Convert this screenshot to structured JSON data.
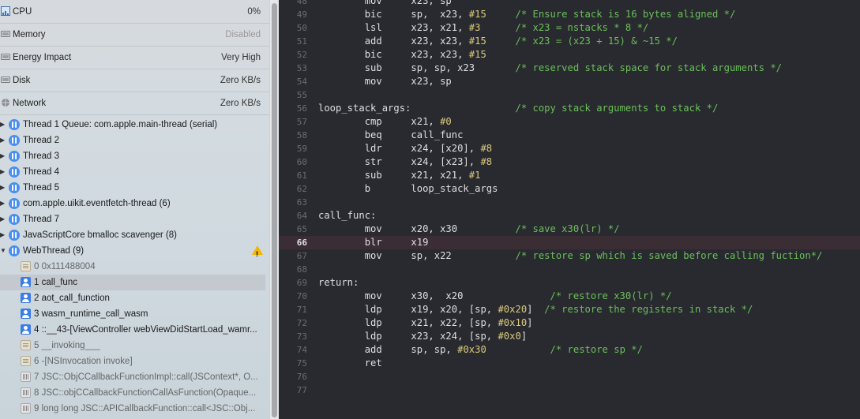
{
  "gauges": [
    {
      "name": "CPU",
      "value": "0%",
      "icon": "cpu-gauge-icon"
    },
    {
      "name": "Memory",
      "value": "Disabled",
      "icon": "memory-gauge-icon"
    },
    {
      "name": "Energy Impact",
      "value": "Very High",
      "icon": "energy-gauge-icon"
    },
    {
      "name": "Disk",
      "value": "Zero KB/s",
      "icon": "disk-gauge-icon"
    },
    {
      "name": "Network",
      "value": "Zero KB/s",
      "icon": "network-gauge-icon"
    }
  ],
  "threads": [
    "Thread 1 Queue: com.apple.main-thread (serial)",
    "Thread 2",
    "Thread 3",
    "Thread 4",
    "Thread 5",
    "com.apple.uikit.eventfetch-thread (6)",
    "Thread 7",
    "JavaScriptCore bmalloc scavenger (8)",
    "WebThread (9)"
  ],
  "frames": [
    {
      "label": "0 0x111488004",
      "kind": "sys"
    },
    {
      "label": "1 call_func",
      "kind": "user"
    },
    {
      "label": "2 aot_call_function",
      "kind": "user"
    },
    {
      "label": "3 wasm_runtime_call_wasm",
      "kind": "user"
    },
    {
      "label": "4 ::__43-[ViewController webViewDidStartLoad_wamr...",
      "kind": "user"
    },
    {
      "label": "5 __invoking___",
      "kind": "sys"
    },
    {
      "label": "6 -[NSInvocation invoke]",
      "kind": "sys"
    },
    {
      "label": "7 JSC::ObjCCallbackFunctionImpl::call(JSContext*, O...",
      "kind": "lib"
    },
    {
      "label": "8 JSC::objCCallbackFunctionCallAsFunction(Opaque...",
      "kind": "lib"
    },
    {
      "label": "9 long long JSC::APICallbackFunction::call<JSC::Obj...",
      "kind": "lib"
    }
  ],
  "selected_frame": 1,
  "warning_icon": "warning-triangle-icon",
  "code_lines": [
    {
      "n": "48",
      "t": "        mov     x23, sp"
    },
    {
      "n": "49",
      "t": "        bic     sp,  x23, #15     /* Ensure stack is 16 bytes aligned */"
    },
    {
      "n": "50",
      "t": "        lsl     x23, x21, #3      /* x23 = nstacks * 8 */"
    },
    {
      "n": "51",
      "t": "        add     x23, x23, #15     /* x23 = (x23 + 15) & ~15 */"
    },
    {
      "n": "52",
      "t": "        bic     x23, x23, #15"
    },
    {
      "n": "53",
      "t": "        sub     sp, sp, x23       /* reserved stack space for stack arguments */"
    },
    {
      "n": "54",
      "t": "        mov     x23, sp"
    },
    {
      "n": "55",
      "t": ""
    },
    {
      "n": "56",
      "t": "loop_stack_args:                  /* copy stack arguments to stack */"
    },
    {
      "n": "57",
      "t": "        cmp     x21, #0"
    },
    {
      "n": "58",
      "t": "        beq     call_func"
    },
    {
      "n": "59",
      "t": "        ldr     x24, [x20], #8"
    },
    {
      "n": "60",
      "t": "        str     x24, [x23], #8"
    },
    {
      "n": "61",
      "t": "        sub     x21, x21, #1"
    },
    {
      "n": "62",
      "t": "        b       loop_stack_args"
    },
    {
      "n": "63",
      "t": ""
    },
    {
      "n": "64",
      "t": "call_func:"
    },
    {
      "n": "65",
      "t": "        mov     x20, x30          /* save x30(lr) */"
    },
    {
      "n": "66",
      "t": "        blr     x19"
    },
    {
      "n": "67",
      "t": "        mov     sp, x22           /* restore sp which is saved before calling fuction*/"
    },
    {
      "n": "68",
      "t": ""
    },
    {
      "n": "69",
      "t": "return:"
    },
    {
      "n": "70",
      "t": "        mov     x30,  x20               /* restore x30(lr) */"
    },
    {
      "n": "71",
      "t": "        ldp     x19, x20, [sp, #0x20]  /* restore the registers in stack */"
    },
    {
      "n": "72",
      "t": "        ldp     x21, x22, [sp, #0x10]"
    },
    {
      "n": "73",
      "t": "        ldp     x23, x24, [sp, #0x0]"
    },
    {
      "n": "74",
      "t": "        add     sp, sp, #0x30           /* restore sp */"
    },
    {
      "n": "75",
      "t": "        ret"
    },
    {
      "n": "76",
      "t": ""
    },
    {
      "n": "77",
      "t": ""
    }
  ],
  "highlight_line": "66",
  "colors": {
    "editor_bg": "#292a30",
    "comment": "#6bbf59",
    "number": "#d9c97c",
    "highlight": "#3a2e34"
  }
}
